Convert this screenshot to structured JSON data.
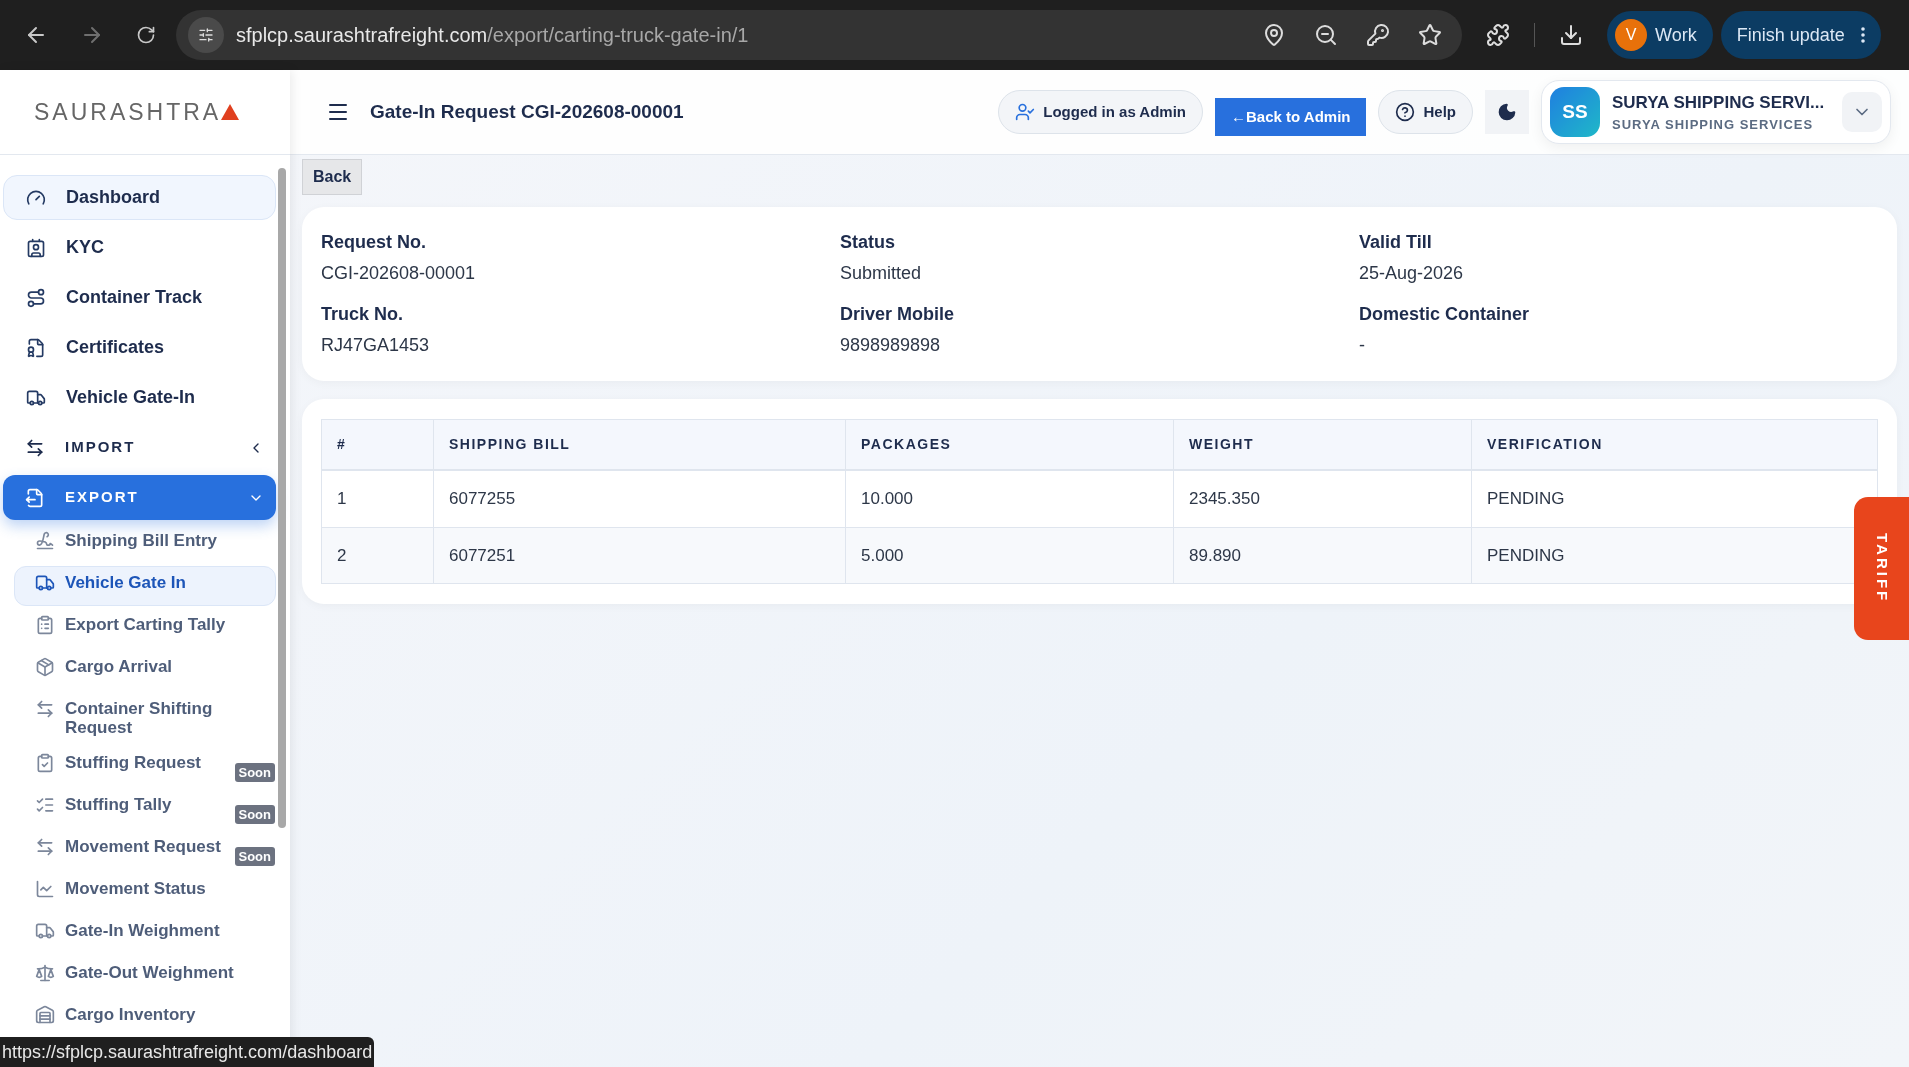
{
  "browser": {
    "url_host": "sfplcp.saurashtrafreight.com",
    "url_path": "/export/carting-truck-gate-in/1",
    "profile_initial": "V",
    "profile_name": "Work",
    "update_button": "Finish update"
  },
  "sidebar": {
    "logo": "SAURASHTRA",
    "items": [
      {
        "kind": "link",
        "label": "Dashboard",
        "hovered": true
      },
      {
        "kind": "link",
        "label": "KYC",
        "hovered": false
      },
      {
        "kind": "link",
        "label": "Container Track",
        "hovered": false
      },
      {
        "kind": "link",
        "label": "Certificates",
        "hovered": false
      },
      {
        "kind": "link",
        "label": "Vehicle Gate-In",
        "hovered": false
      },
      {
        "kind": "group",
        "label": "IMPORT",
        "expanded": false
      },
      {
        "kind": "group",
        "label": "EXPORT",
        "expanded": true,
        "children": [
          {
            "label": "Shipping Bill Entry",
            "selected": false
          },
          {
            "label": "Vehicle Gate In",
            "selected": true
          },
          {
            "label": "Export Carting Tally",
            "selected": false
          },
          {
            "label": "Cargo Arrival",
            "selected": false
          },
          {
            "label": "Container Shifting Request",
            "selected": false
          },
          {
            "label": "Stuffing Request",
            "selected": false,
            "badge": "Soon"
          },
          {
            "label": "Stuffing Tally",
            "selected": false,
            "badge": "Soon"
          },
          {
            "label": "Movement Request",
            "selected": false,
            "badge": "Soon"
          },
          {
            "label": "Movement Status",
            "selected": false
          },
          {
            "label": "Gate-In Weighment",
            "selected": false
          },
          {
            "label": "Gate-Out Weighment",
            "selected": false
          },
          {
            "label": "Cargo Inventory",
            "selected": false
          }
        ]
      }
    ]
  },
  "header": {
    "title": "Gate-In Request CGI-202608-00001",
    "logged_in": "Logged in as Admin",
    "back_to_admin": "←Back to Admin",
    "help": "Help",
    "user_initials": "SS",
    "user_name": "SURYA SHIPPING SERVI...",
    "user_org": "SURYA SHIPPING SERVICES"
  },
  "back_button": "Back",
  "details": [
    {
      "label": "Request No.",
      "value": "CGI-202608-00001"
    },
    {
      "label": "Status",
      "value": "Submitted"
    },
    {
      "label": "Valid Till",
      "value": "25-Aug-2026"
    },
    {
      "label": "Truck No.",
      "value": "RJ47GA1453"
    },
    {
      "label": "Driver Mobile",
      "value": "9898989898"
    },
    {
      "label": "Domestic Container",
      "value": "-"
    }
  ],
  "table": {
    "columns": [
      "#",
      "SHIPPING BILL",
      "PACKAGES",
      "WEIGHT",
      "VERIFICATION"
    ],
    "rows": [
      [
        "1",
        "6077255",
        "10.000",
        "2345.350",
        "PENDING"
      ],
      [
        "2",
        "6077251",
        "5.000",
        "89.890",
        "PENDING"
      ]
    ]
  },
  "tariff_tab": "TARIFF",
  "status_url": "https://sfplcp.saurashtrafreight.com/dashboard"
}
